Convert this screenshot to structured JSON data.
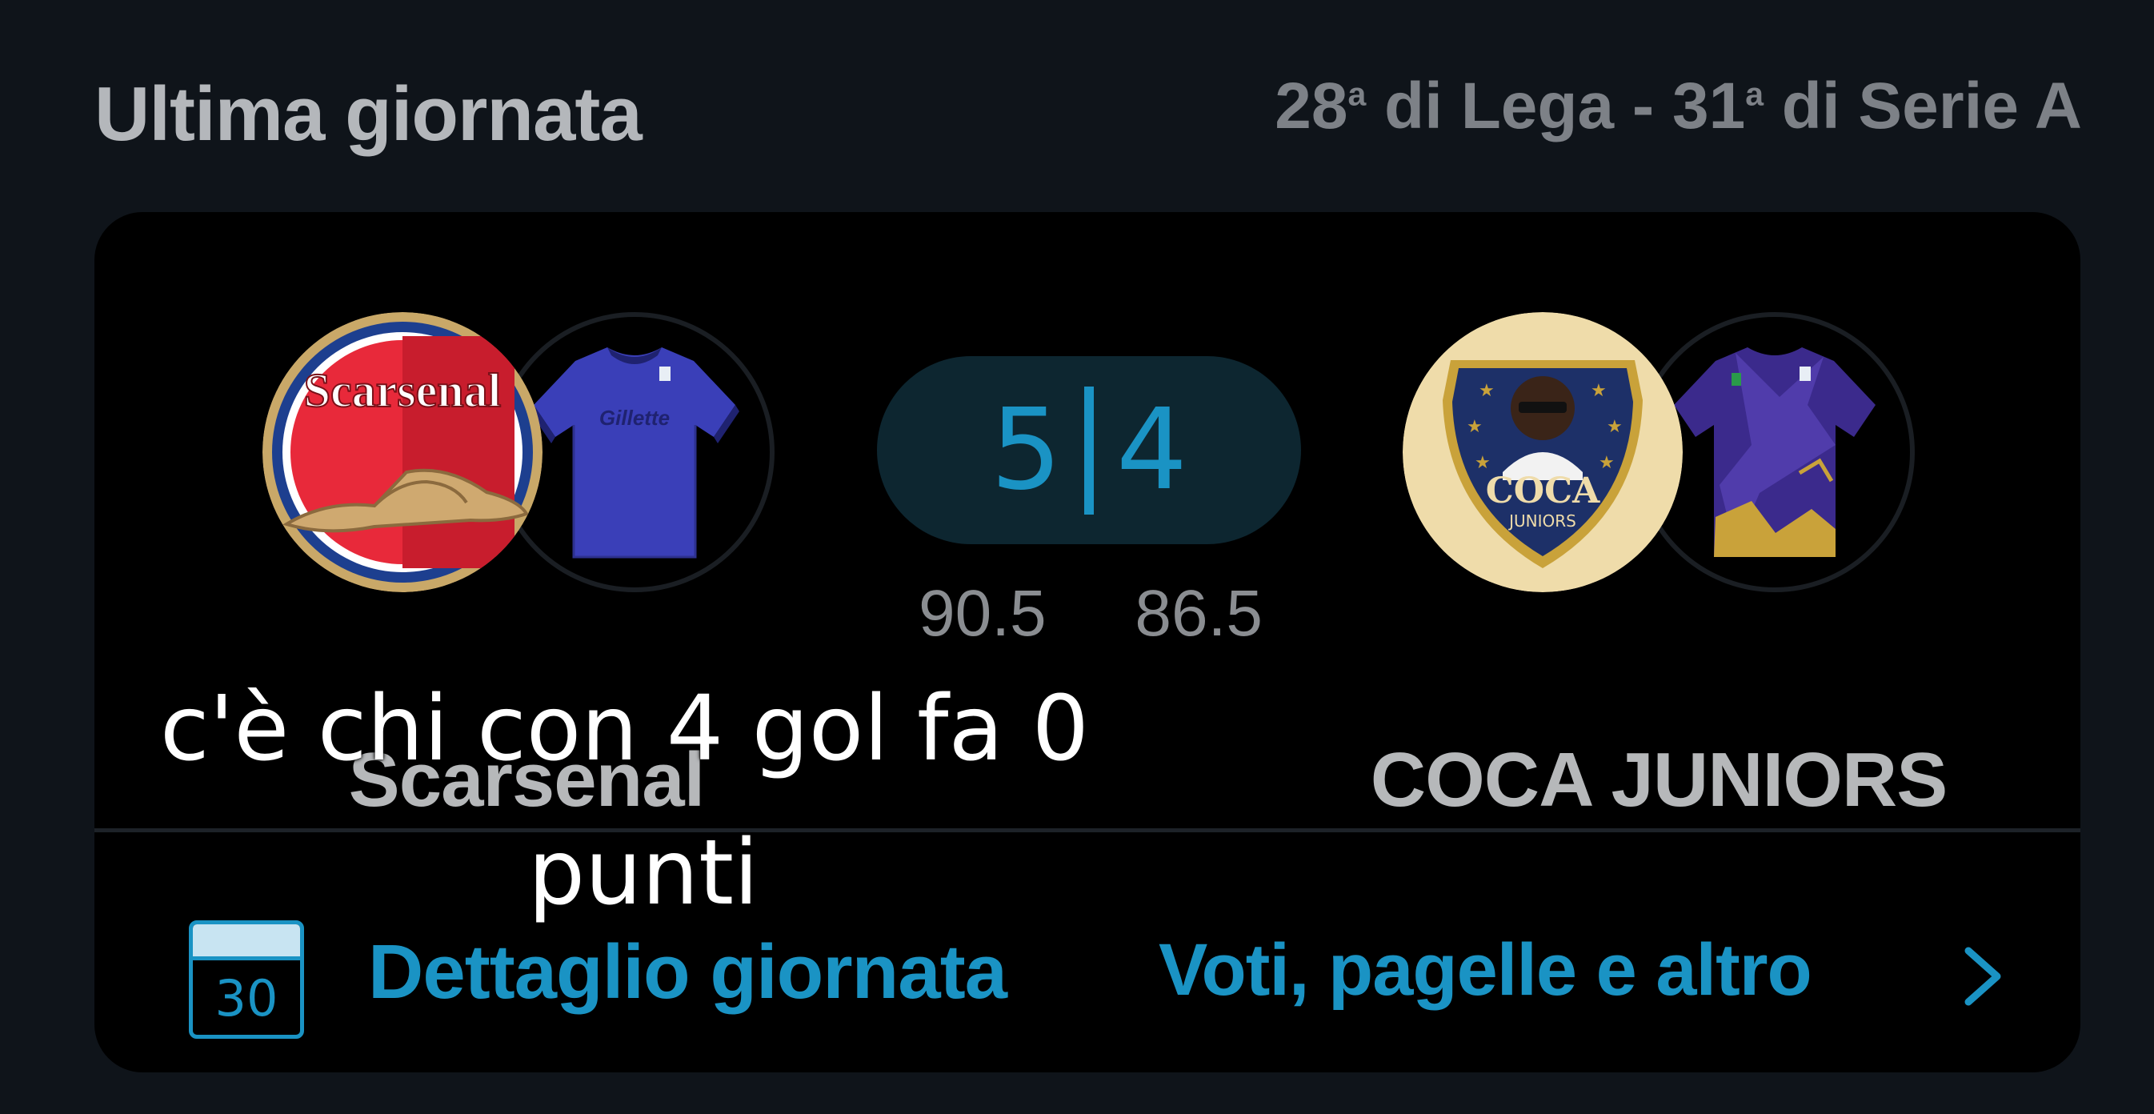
{
  "header": {
    "title": "Ultima giornata",
    "round": {
      "league_round": "28",
      "league_label": " di Lega - ",
      "seriea_round": "31",
      "seriea_label": " di Serie A",
      "ordinal": "a"
    }
  },
  "match": {
    "home": {
      "name": "Scarsenal",
      "logo_text": "Scarsenal",
      "jersey_sponsor": "Gillette"
    },
    "away": {
      "name": "COCA JUNIORS",
      "logo_text": "COCA",
      "logo_subtext": "JUNIORS"
    },
    "score": {
      "home_goals": "5",
      "away_goals": "4"
    },
    "points": {
      "home": "90.5",
      "away": "86.5"
    }
  },
  "footer": {
    "calendar_day": "30",
    "detail_label": "Dettaglio giornata",
    "detail_sub": "Voti, pagelle e altro",
    "icon": "chevron-right-icon"
  },
  "overlay_caption": {
    "line1": "c'è chi con 4 gol fa 0",
    "line2": "punti"
  },
  "colors": {
    "background": "#0f141a",
    "card": "#000000",
    "accent": "#1a93c4",
    "pill": "#0d2630",
    "title": "#b4b7bb",
    "muted": "#7d8187"
  }
}
